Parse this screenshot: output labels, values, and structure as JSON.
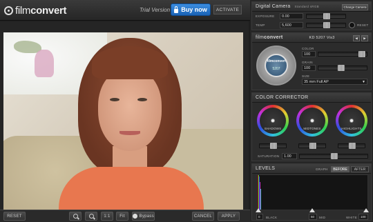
{
  "app": {
    "logo_light": "film",
    "logo_bold": "convert",
    "trial_text": "Trial Version",
    "buy_label": "Buy now",
    "activate_label": "ACTIVATE"
  },
  "toolbar": {
    "reset": "RESET",
    "zoom_in": "zoom-in-icon",
    "zoom_out": "zoom-out-icon",
    "one_to_one": "1:1",
    "fit": "Fit",
    "bypass": "Bypass",
    "cancel": "CANCEL",
    "apply": "APPLY"
  },
  "camera": {
    "title": "Digital Camera",
    "profile": "Standard sRGB",
    "change_label": "Change Camera",
    "exposure_label": "EXPOSURE",
    "exposure_value": "0.00",
    "temp_label": "TEMP",
    "temp_value": "5,600",
    "reset_label": "RESET"
  },
  "film": {
    "logo_light": "film",
    "logo_bold": "convert",
    "stock": "KD 5207 Vis3",
    "canister_logo": "filmconvert",
    "canister_num": "5207",
    "color_label": "COLOR",
    "color_value": "100",
    "grain_label": "GRAIN",
    "grain_value": "100",
    "size_label": "SIZE",
    "size_value": "35 mm Full AP"
  },
  "corrector": {
    "title": "COLOR CORRECTOR",
    "wheels": [
      "SHADOWS",
      "MIDTONES",
      "HIGHLIGHTS"
    ],
    "saturation_label": "SATURATION",
    "saturation_value": "1.00"
  },
  "levels": {
    "title": "LEVELS",
    "graph_label": "GRAPH",
    "before": "BEFORE",
    "after": "AFTER",
    "black_value": "0",
    "black_label": "BLACK",
    "mid_value": "50",
    "mid_label": "MID",
    "white_label": "WHITE",
    "white_value": "100"
  },
  "colors": {
    "accent": "#1f6fc7",
    "panel": "#2c2c2c",
    "background": "#1e1e1e"
  }
}
